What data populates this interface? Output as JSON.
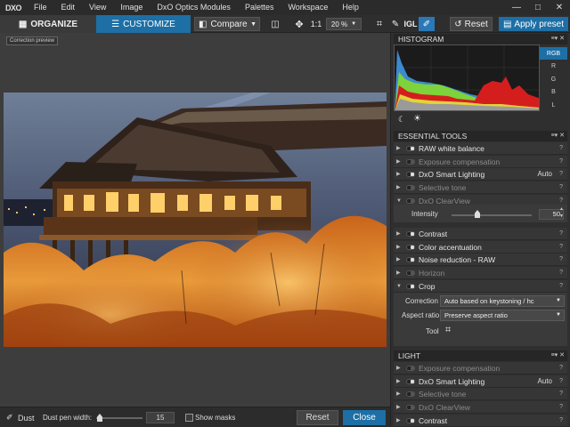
{
  "app": {
    "logo": "DXO"
  },
  "menu": [
    "File",
    "Edit",
    "View",
    "Image",
    "DxO Optics Modules",
    "Palettes",
    "Workspace",
    "Help"
  ],
  "window_controls": {
    "minimize": "—",
    "maximize": "□",
    "close": "✕"
  },
  "toolbar": {
    "organize_label": "ORGANIZE",
    "customize_label": "CUSTOMIZE",
    "compare_label": "Compare",
    "zoom_one": "1:1",
    "zoom_value": "20 %",
    "level_label": "IGL",
    "reset_label": "Reset",
    "apply_label": "Apply preset"
  },
  "viewer": {
    "preview_label": "Correction preview"
  },
  "bottombar": {
    "dust_label": "Dust",
    "pen_width_label": "Dust pen width:",
    "pen_width_value": "15",
    "show_masks_label": "Show masks",
    "reset_label": "Reset",
    "close_label": "Close"
  },
  "histogram": {
    "title": "HISTOGRAM",
    "channels": [
      "RGB",
      "R",
      "G",
      "B",
      "L"
    ],
    "selected": "RGB"
  },
  "essential_tools": {
    "title": "ESSENTIAL TOOLS",
    "rows": [
      {
        "label": "RAW white balance",
        "value": "",
        "dim": false,
        "expanded": false
      },
      {
        "label": "Exposure compensation",
        "value": "",
        "dim": true,
        "expanded": false
      },
      {
        "label": "DxO Smart Lighting",
        "value": "Auto",
        "dim": false,
        "expanded": false
      },
      {
        "label": "Selective tone",
        "value": "",
        "dim": true,
        "expanded": false
      },
      {
        "label": "DxO ClearView",
        "value": "",
        "dim": true,
        "expanded": true
      }
    ],
    "intensity_label": "Intensity",
    "intensity_value": "50",
    "rows2": [
      {
        "label": "Contrast",
        "value": "",
        "dim": false
      },
      {
        "label": "Color accentuation",
        "value": "",
        "dim": false
      },
      {
        "label": "Noise reduction - RAW",
        "value": "",
        "dim": false
      },
      {
        "label": "Horizon",
        "value": "",
        "dim": true
      },
      {
        "label": "Crop",
        "value": "",
        "dim": false
      }
    ],
    "crop": {
      "correction_label": "Correction",
      "correction_value": "Auto based on keystoning / hc",
      "aspect_label": "Aspect ratio",
      "aspect_value": "Preserve aspect ratio",
      "tool_label": "Tool"
    }
  },
  "light": {
    "title": "LIGHT",
    "rows": [
      {
        "label": "Exposure compensation",
        "value": "",
        "dim": true
      },
      {
        "label": "DxO Smart Lighting",
        "value": "Auto",
        "dim": false
      },
      {
        "label": "Selective tone",
        "value": "",
        "dim": true
      },
      {
        "label": "DxO ClearView",
        "value": "",
        "dim": true
      },
      {
        "label": "Contrast",
        "value": "",
        "dim": false
      }
    ]
  },
  "help_glyph": "?",
  "header_ctrls": "≡▾ ✕",
  "colors": {
    "accent": "#1d6fa5"
  }
}
